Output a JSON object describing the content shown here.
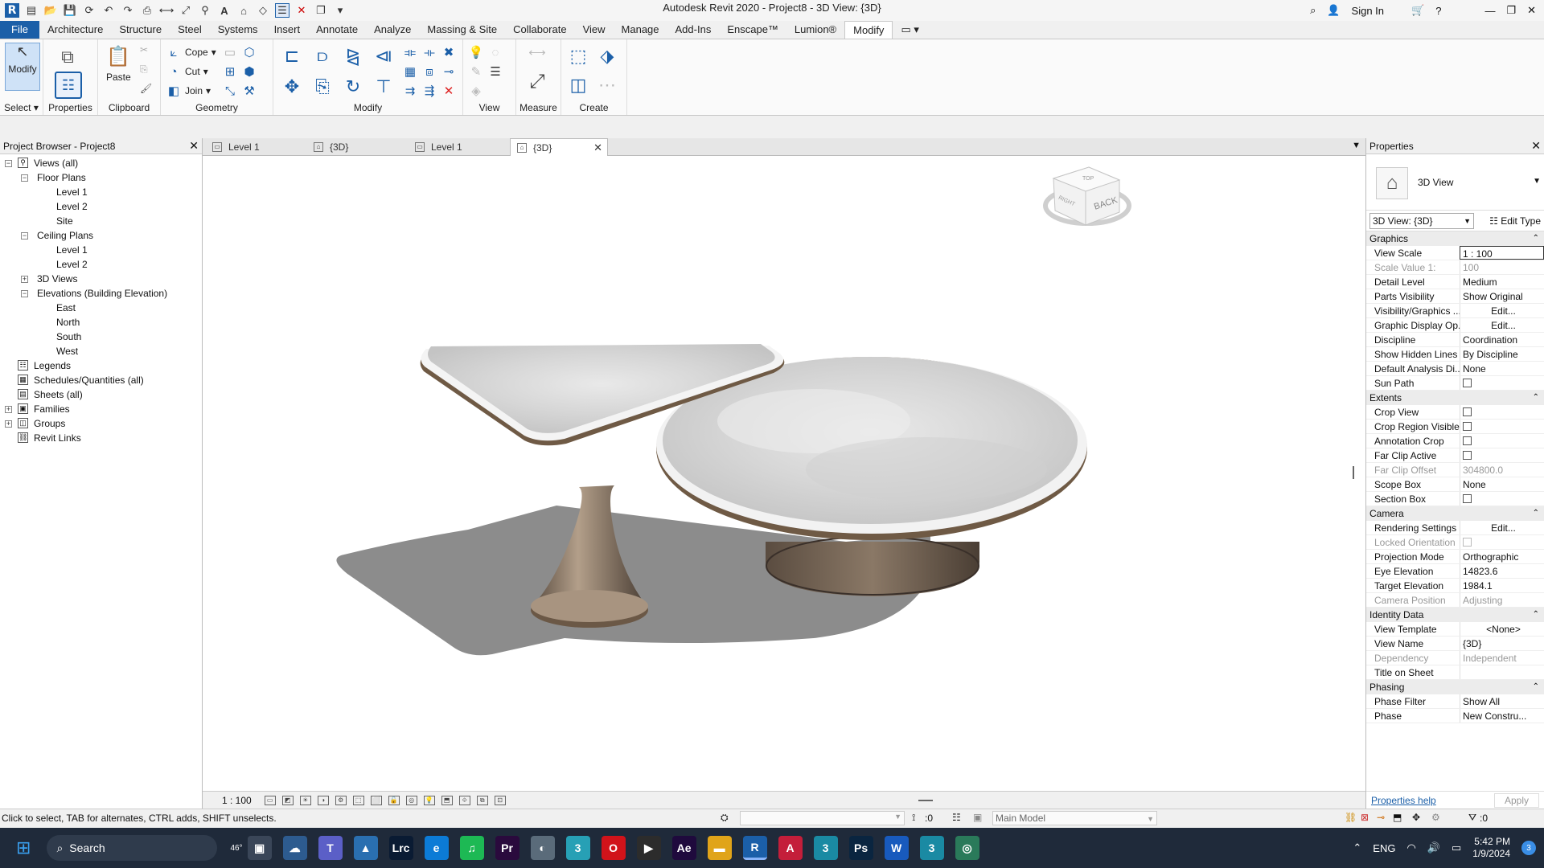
{
  "window": {
    "title": "Autodesk Revit 2020 - Project8 - 3D View: {3D}",
    "sign_in": "Sign In",
    "logo": "R"
  },
  "menu_tabs": [
    "File",
    "Architecture",
    "Structure",
    "Steel",
    "Systems",
    "Insert",
    "Annotate",
    "Analyze",
    "Massing & Site",
    "Collaborate",
    "View",
    "Manage",
    "Add-Ins",
    "Enscape™",
    "Lumion®",
    "Modify"
  ],
  "active_menu_tab": "Modify",
  "ribbon": {
    "modify_label": "Modify",
    "properties_label": "Properties",
    "paste_label": "Paste",
    "cope_label": "Cope",
    "cut_label": "Cut",
    "join_label": "Join",
    "panels": {
      "select": "Select",
      "properties": "Properties",
      "clipboard": "Clipboard",
      "geometry": "Geometry",
      "modify": "Modify",
      "view": "View",
      "measure": "Measure",
      "create": "Create"
    }
  },
  "project_browser": {
    "title": "Project Browser - Project8",
    "items": [
      {
        "label": "Views (all)",
        "level": 0,
        "toggle": "−",
        "icon": "views"
      },
      {
        "label": "Floor Plans",
        "level": 1,
        "toggle": "−"
      },
      {
        "label": "Level 1",
        "level": 2
      },
      {
        "label": "Level 2",
        "level": 2
      },
      {
        "label": "Site",
        "level": 2
      },
      {
        "label": "Ceiling Plans",
        "level": 1,
        "toggle": "−"
      },
      {
        "label": "Level 1",
        "level": 2
      },
      {
        "label": "Level 2",
        "level": 2
      },
      {
        "label": "3D Views",
        "level": 1,
        "toggle": "+"
      },
      {
        "label": "Elevations (Building Elevation)",
        "level": 1,
        "toggle": "−"
      },
      {
        "label": "East",
        "level": 2
      },
      {
        "label": "North",
        "level": 2
      },
      {
        "label": "South",
        "level": 2
      },
      {
        "label": "West",
        "level": 2
      },
      {
        "label": "Legends",
        "level": 0,
        "icon": "legend"
      },
      {
        "label": "Schedules/Quantities (all)",
        "level": 0,
        "icon": "schedule"
      },
      {
        "label": "Sheets (all)",
        "level": 0,
        "icon": "sheet"
      },
      {
        "label": "Families",
        "level": 0,
        "toggle": "+",
        "icon": "family"
      },
      {
        "label": "Groups",
        "level": 0,
        "toggle": "+",
        "icon": "group"
      },
      {
        "label": "Revit Links",
        "level": 0,
        "icon": "link"
      }
    ]
  },
  "view_tabs": [
    {
      "label": "Level 1",
      "icon": "plan",
      "active": false
    },
    {
      "label": "{3D}",
      "icon": "3d",
      "active": false
    },
    {
      "label": "Level 1",
      "icon": "plan",
      "active": false
    },
    {
      "label": "{3D}",
      "icon": "3d",
      "active": true
    }
  ],
  "viewcube": {
    "face": "BACK",
    "side": "RIGHT",
    "top": "TOP"
  },
  "view_control": {
    "scale": "1 : 100"
  },
  "properties": {
    "title": "Properties",
    "type_name": "3D View",
    "instance": "3D View: {3D}",
    "edit_type": "Edit Type",
    "groups": [
      {
        "name": "Graphics",
        "rows": [
          {
            "k": "View Scale",
            "v": "1 : 100",
            "style": "box"
          },
          {
            "k": "Scale Value    1:",
            "v": "100",
            "style": "dis"
          },
          {
            "k": "Detail Level",
            "v": "Medium"
          },
          {
            "k": "Parts Visibility",
            "v": "Show Original"
          },
          {
            "k": "Visibility/Graphics ...",
            "v": "Edit...",
            "style": "btn"
          },
          {
            "k": "Graphic Display Op...",
            "v": "Edit...",
            "style": "btn"
          },
          {
            "k": "Discipline",
            "v": "Coordination"
          },
          {
            "k": "Show Hidden Lines",
            "v": "By Discipline"
          },
          {
            "k": "Default Analysis Di...",
            "v": "None"
          },
          {
            "k": "Sun Path",
            "v": "",
            "style": "cb"
          }
        ]
      },
      {
        "name": "Extents",
        "rows": [
          {
            "k": "Crop View",
            "v": "",
            "style": "cb"
          },
          {
            "k": "Crop Region Visible",
            "v": "",
            "style": "cb"
          },
          {
            "k": "Annotation Crop",
            "v": "",
            "style": "cb"
          },
          {
            "k": "Far Clip Active",
            "v": "",
            "style": "cb"
          },
          {
            "k": "Far Clip Offset",
            "v": "304800.0",
            "style": "dis"
          },
          {
            "k": "Scope Box",
            "v": "None"
          },
          {
            "k": "Section Box",
            "v": "",
            "style": "cb"
          }
        ]
      },
      {
        "name": "Camera",
        "rows": [
          {
            "k": "Rendering Settings",
            "v": "Edit...",
            "style": "btn"
          },
          {
            "k": "Locked Orientation",
            "v": "",
            "style": "cbd"
          },
          {
            "k": "Projection Mode",
            "v": "Orthographic"
          },
          {
            "k": "Eye Elevation",
            "v": "14823.6"
          },
          {
            "k": "Target Elevation",
            "v": "1984.1"
          },
          {
            "k": "Camera Position",
            "v": "Adjusting",
            "style": "dis"
          }
        ]
      },
      {
        "name": "Identity Data",
        "rows": [
          {
            "k": "View Template",
            "v": "<None>",
            "style": "btn"
          },
          {
            "k": "View Name",
            "v": "{3D}"
          },
          {
            "k": "Dependency",
            "v": "Independent",
            "style": "dis"
          },
          {
            "k": "Title on Sheet",
            "v": ""
          }
        ]
      },
      {
        "name": "Phasing",
        "rows": [
          {
            "k": "Phase Filter",
            "v": "Show All"
          },
          {
            "k": "Phase",
            "v": "New Constru..."
          }
        ]
      }
    ],
    "help_link": "Properties help",
    "apply": "Apply"
  },
  "status_bar": {
    "message": "Click to select, TAB for alternates, CTRL adds, SHIFT unselects.",
    "counter": ":0",
    "model": "Main Model",
    "filter_count": ":0"
  },
  "taskbar": {
    "search": "Search",
    "weather": "46°",
    "lang": "ENG",
    "time": "5:42 PM",
    "date": "1/9/2024",
    "notifications": "3",
    "apps": [
      {
        "name": "task-view",
        "glyph": "▣",
        "color": "#3a4658"
      },
      {
        "name": "weather",
        "glyph": "☁",
        "color": "#2d5b8f"
      },
      {
        "name": "teams",
        "glyph": "T",
        "color": "#5b5fc7"
      },
      {
        "name": "photos",
        "glyph": "▲",
        "color": "#2a6fb0"
      },
      {
        "name": "lightroom-classic",
        "glyph": "Lrc",
        "color": "#0a1b33"
      },
      {
        "name": "edge",
        "glyph": "e",
        "color": "#0c7bd6"
      },
      {
        "name": "spotify",
        "glyph": "♫",
        "color": "#1db954"
      },
      {
        "name": "premiere",
        "glyph": "Pr",
        "color": "#2a0a3d"
      },
      {
        "name": "globe",
        "glyph": "◐",
        "color": "#5a6b7a"
      },
      {
        "name": "3dsmax",
        "glyph": "3",
        "color": "#27a0b5"
      },
      {
        "name": "opera",
        "glyph": "O",
        "color": "#d1131a"
      },
      {
        "name": "media",
        "glyph": "▶",
        "color": "#2c2c2c"
      },
      {
        "name": "after-effects",
        "glyph": "Ae",
        "color": "#1f0a3d"
      },
      {
        "name": "file-explorer",
        "glyph": "▬",
        "color": "#e0a419"
      },
      {
        "name": "revit",
        "glyph": "R",
        "color": "#1b5fa8"
      },
      {
        "name": "autocad",
        "glyph": "A",
        "color": "#c41e3a"
      },
      {
        "name": "3dsmax-2",
        "glyph": "3",
        "color": "#1a8aa3"
      },
      {
        "name": "photoshop",
        "glyph": "Ps",
        "color": "#0a2540"
      },
      {
        "name": "word",
        "glyph": "W",
        "color": "#185abd"
      },
      {
        "name": "3dsmax-3",
        "glyph": "3",
        "color": "#1a8aa3"
      },
      {
        "name": "network",
        "glyph": "◎",
        "color": "#2a7a5a"
      }
    ]
  },
  "colors": {
    "accent": "#1b5fa8",
    "marble": "#dcdcdc",
    "wood": "#7a6a5a",
    "shadow": "#8a8a8a"
  }
}
